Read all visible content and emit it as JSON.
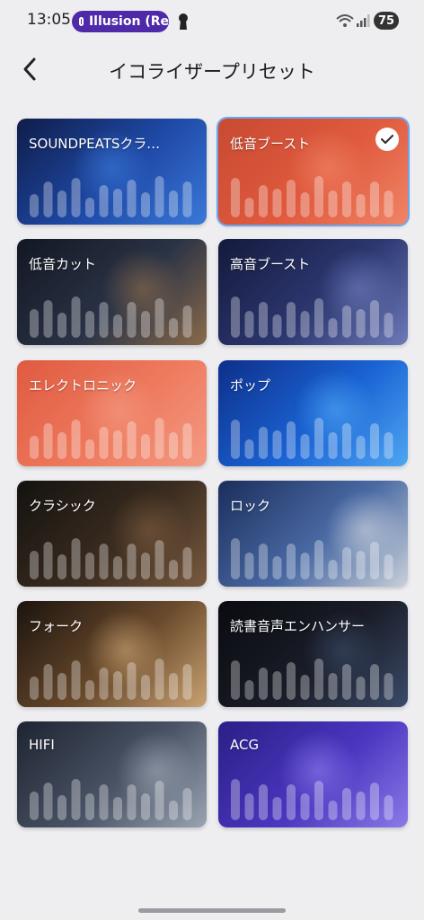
{
  "status": {
    "time": "13:05",
    "pill_text": "Illusion (Re",
    "battery": "75"
  },
  "header": {
    "title": "イコライザープリセット"
  },
  "presets": [
    {
      "label": "SOUNDPEATSクラシッ…",
      "selected": false,
      "colors": [
        "#0f1d4a",
        "#1f4aa8",
        "#3a78d8"
      ]
    },
    {
      "label": "低音ブースト",
      "selected": true,
      "colors": [
        "#c84a32",
        "#e05a3e",
        "#f08466"
      ]
    },
    {
      "label": "低音カット",
      "selected": false,
      "colors": [
        "#121722",
        "#2a3346",
        "#8a6a4a"
      ]
    },
    {
      "label": "高音ブースト",
      "selected": false,
      "colors": [
        "#141a3c",
        "#2c3770",
        "#6c7ab8"
      ]
    },
    {
      "label": "エレクトロニック",
      "selected": false,
      "colors": [
        "#e05a40",
        "#ee7a5e",
        "#f39a82"
      ]
    },
    {
      "label": "ポップ",
      "selected": false,
      "colors": [
        "#0e2f8a",
        "#1a63d4",
        "#4ea6f2"
      ]
    },
    {
      "label": "クラシック",
      "selected": false,
      "colors": [
        "#14120f",
        "#3a2c20",
        "#7a5a3e"
      ]
    },
    {
      "label": "ロック",
      "selected": false,
      "colors": [
        "#1b2e5c",
        "#4a6aa4",
        "#c8d0da"
      ]
    },
    {
      "label": "フォーク",
      "selected": false,
      "colors": [
        "#1c140e",
        "#6a4a2c",
        "#c8a272"
      ]
    },
    {
      "label": "読書音声エンハンサー",
      "selected": false,
      "colors": [
        "#0a0b10",
        "#1a1d28",
        "#3a4a68"
      ]
    },
    {
      "label": "HIFI",
      "selected": false,
      "colors": [
        "#1e2430",
        "#4a5466",
        "#9aa4b2"
      ]
    },
    {
      "label": "ACG",
      "selected": false,
      "colors": [
        "#2a1f86",
        "#4a36c0",
        "#8a7ae8"
      ]
    }
  ],
  "icons": {
    "back": "chevron-left-icon",
    "check": "checkmark-icon",
    "wifi": "wifi-icon",
    "signal": "cell-signal-icon",
    "keyhole": "keyhole-icon"
  }
}
